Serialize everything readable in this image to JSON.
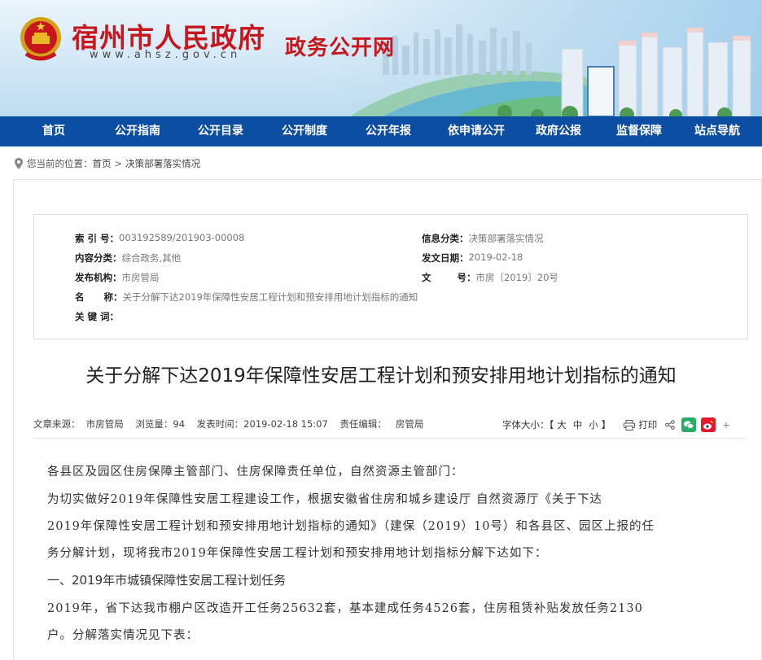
{
  "header": {
    "site_title": "宿州市人民政府",
    "site_url": "www.ahsz.gov.cn",
    "site_subtitle": "政务公开网"
  },
  "nav": {
    "items": [
      {
        "label": "首页"
      },
      {
        "label": "公开指南"
      },
      {
        "label": "公开目录"
      },
      {
        "label": "公开制度"
      },
      {
        "label": "公开年报"
      },
      {
        "label": "依申请公开"
      },
      {
        "label": "政府公报"
      },
      {
        "label": "监督保障"
      },
      {
        "label": "站点导航"
      }
    ]
  },
  "breadcrumb": {
    "prefix": "您当前的位置：",
    "home": "首页",
    "separator": ">",
    "current": "决策部署落实情况"
  },
  "meta": {
    "index_label": "索 引 号：",
    "index_value": "003192589/201903-00008",
    "category_label": "信息分类：",
    "category_value": "决策部署落实情况",
    "content_label": "内容分类：",
    "content_value": "综合政务,其他",
    "date_label": "发文日期：",
    "date_value": "2019-02-18",
    "publisher_label": "发布机构：",
    "publisher_value": "市房管局",
    "docno_label": "文        号：",
    "docno_value": "市房〔2019〕20号",
    "name_label": "名      称：",
    "name_value": "关于分解下达2019年保障性安居工程计划和预安排用地计划指标的通知",
    "keywords_label": "关 键 词："
  },
  "article": {
    "title": "关于分解下达2019年保障性安居工程计划和预安排用地计划指标的通知",
    "info": "文章来源：  市房管局    浏览量：94    发表时间：2019-02-18 15:07    责任编辑：   房管局",
    "font_size_label": "字体大小：【",
    "font_large": "大",
    "font_medium": "中",
    "font_small": "小",
    "font_size_end": "】",
    "print_label": "打印",
    "plus": "+",
    "paragraphs": [
      "各县区及园区住房保障主管部门、住房保障责任单位，自然资源主管部门：",
      "    为切实做好2019年保障性安居工程建设工作，根据安徽省住房和城乡建设厅 自然资源厅《关于下达",
      "2019年保障性安居工程计划和预安排用地计划指标的通知》（建保（2019）10号）和各县区、园区上报的任",
      "务分解计划，现将我市2019年保障性安居工程计划和预安排用地计划指标分解下达如下：",
      "    一、2019年市城镇保障性安居工程计划任务",
      "    2019年，省下达我市棚户区改造开工任务25632套，基本建成任务4526套，住房租赁补贴发放任务2130",
      "户。分解落实情况见下表："
    ]
  },
  "colors": {
    "brand_red": "#c8161d",
    "nav_blue": "#0c4ea2",
    "wechat_green": "#2aae67",
    "weibo_red": "#e6162d"
  }
}
